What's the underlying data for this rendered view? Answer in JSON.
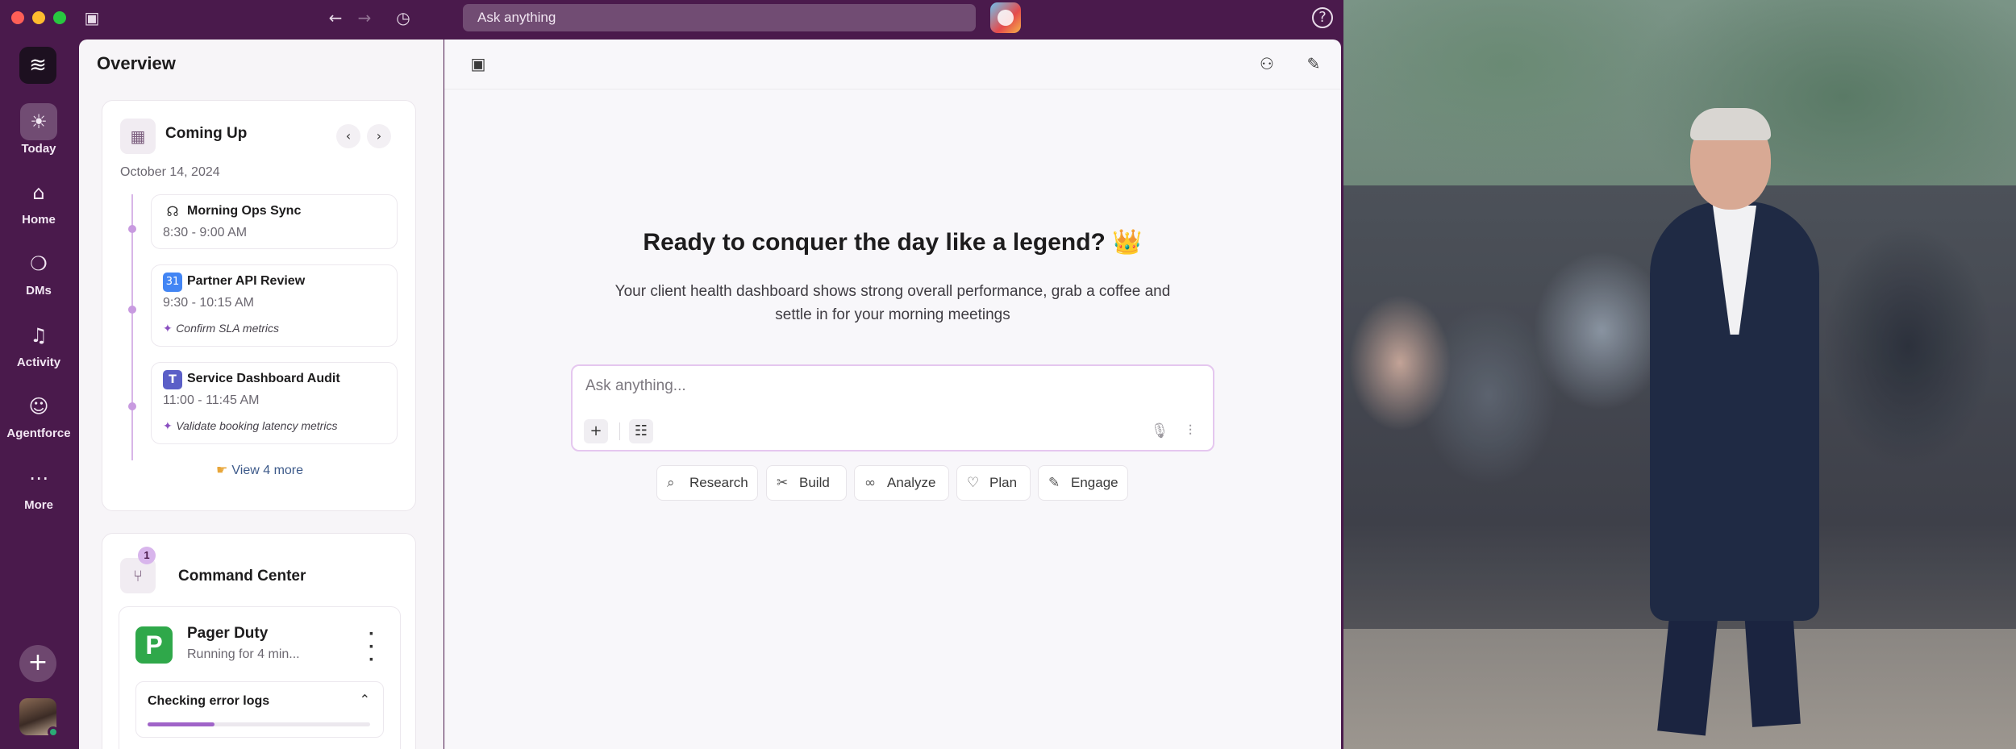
{
  "titlebar": {
    "search_placeholder": "Ask anything"
  },
  "rail": {
    "items": [
      {
        "label": "Today",
        "icon": "sun-icon"
      },
      {
        "label": "Home",
        "icon": "home-icon"
      },
      {
        "label": "DMs",
        "icon": "chat-bubbles-icon"
      },
      {
        "label": "Activity",
        "icon": "bell-icon"
      },
      {
        "label": "Agentforce",
        "icon": "robot-icon"
      },
      {
        "label": "More",
        "icon": "ellipsis-icon"
      }
    ]
  },
  "overview": {
    "title": "Overview",
    "coming_up": {
      "title": "Coming Up",
      "date": "October 14, 2024",
      "events": [
        {
          "name": "Morning Ops Sync",
          "time": "8:30 - 9:00 AM",
          "note": ""
        },
        {
          "name": "Partner API Review",
          "time": "9:30 - 10:15 AM",
          "note": "Confirm SLA metrics"
        },
        {
          "name": "Service Dashboard Audit",
          "time": "11:00 - 11:45 AM",
          "note": "Validate booking latency metrics"
        }
      ],
      "view_more": "View 4 more"
    },
    "command_center": {
      "title": "Command Center",
      "badge": "1",
      "agent": {
        "logo_letter": "P",
        "name": "Pager Duty",
        "status": "Running for 4 min...",
        "task": "Checking error logs",
        "progress": 0.3
      }
    }
  },
  "main": {
    "headline": "Ready to conquer the day like a legend? 👑",
    "subline_1": "Your client health dashboard shows strong overall performance, grab a coffee and",
    "subline_2": "settle in for your morning meetings",
    "ask_placeholder": "Ask anything...",
    "chips": [
      "Research",
      "Build",
      "Analyze",
      "Plan",
      "Engage"
    ]
  },
  "colors": {
    "aubergine": "#4a1a4c",
    "accent": "#a064c8",
    "pager_green": "#2fa84a"
  }
}
